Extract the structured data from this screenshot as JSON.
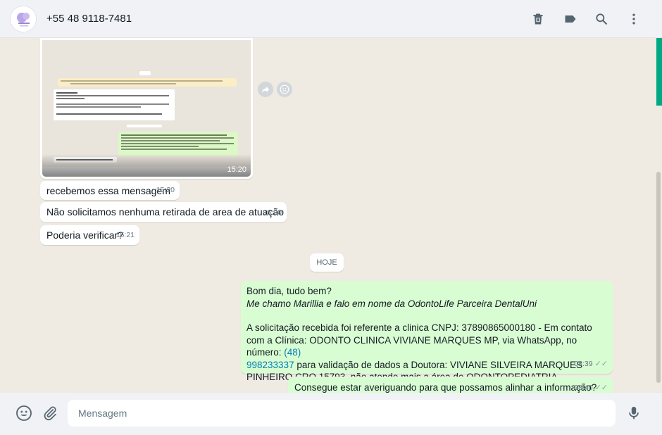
{
  "header": {
    "contact_name": "+55 48 9118-7481",
    "icons": [
      "delete-icon",
      "label-icon",
      "search-icon",
      "more-options-icon"
    ]
  },
  "image_message": {
    "time": "15:20"
  },
  "messages_in": [
    {
      "text": "recebemos essa mensagem",
      "time": "15:20"
    },
    {
      "text": "Não solicitamos nenhuma retirada de area de atuação",
      "time": "15:20"
    },
    {
      "text": "Poderia verificar?",
      "time": "15:21"
    }
  ],
  "date_divider": "HOJE",
  "outgoing_main": {
    "line1": "Bom dia, tudo bem?",
    "line2": "Me chamo Marillia e falo em nome da OdontoLife Parceira DentalUni",
    "para_a": "A solicitação recebida foi referente a clinica CNPJ: 37890865000180 - Em contato com a Clínica: ODONTO CLINICA VIVIANE MARQUES MP, via WhatsApp, no número: ",
    "link_a": "(48)",
    "link_b": "998233337",
    "para_b": " para validação de dados a Doutora: VIVIANE SILVEIRA MARQUES PINHEIRO CRO 15793, não atende mais a área de ODONTOPEDIATRIA.",
    "time": "08:39"
  },
  "outgoing_second": {
    "text": "Consegue estar averiguando para que possamos alinhar a informação?",
    "time": "08:40"
  },
  "footer": {
    "placeholder": "Mensagem",
    "icons": [
      "emoji-icon",
      "attach-icon",
      "microphone-icon"
    ]
  },
  "colors": {
    "header_bg": "#f0f2f5",
    "chat_bg": "#efeae2",
    "outgoing_bg": "#d9fdd3",
    "incoming_bg": "#ffffff",
    "accent": "#00a884",
    "link": "#027eb5"
  }
}
